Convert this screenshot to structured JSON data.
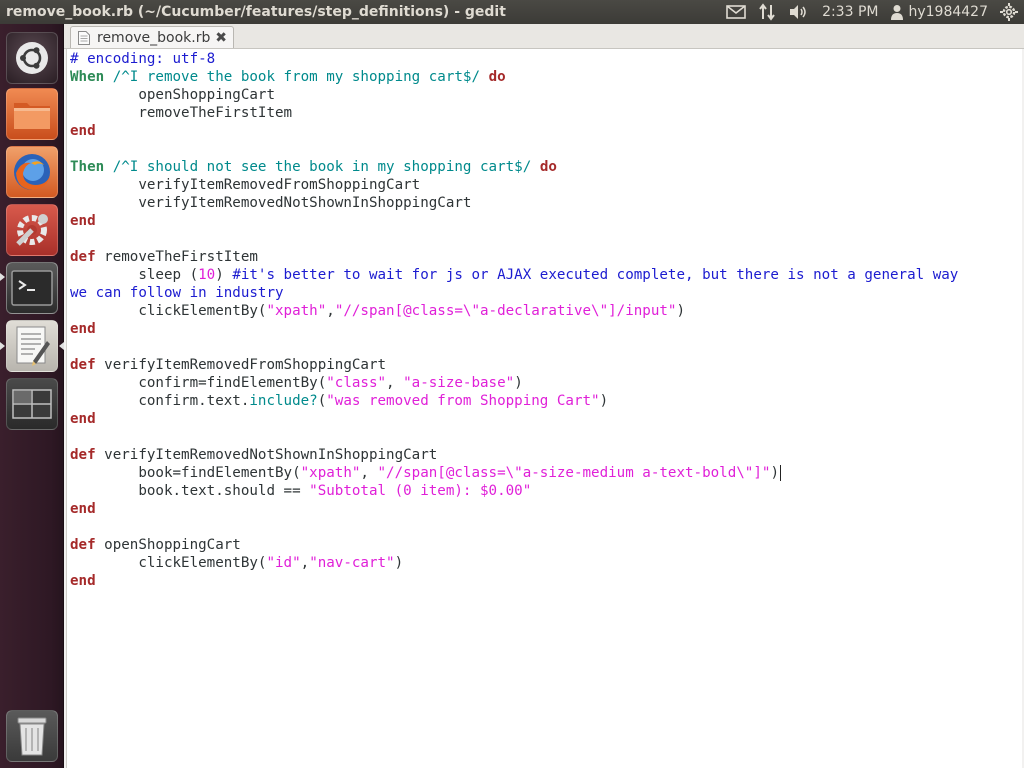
{
  "topbar": {
    "window_title": "remove_book.rb (~/Cucumber/features/step_definitions) - gedit",
    "clock": "2:33 PM",
    "username": "hy1984427",
    "indicator_icons": [
      "mail-icon",
      "network-icon",
      "volume-icon",
      "user-icon",
      "gear-icon"
    ]
  },
  "launcher": {
    "items": [
      "ubuntu-dash-icon",
      "files-icon",
      "firefox-icon",
      "system-settings-icon",
      "terminal-icon",
      "text-editor-icon",
      "workspace-switcher-icon",
      "trash-icon"
    ]
  },
  "editor": {
    "tab_label": "remove_book.rb",
    "tab_icon": "document-icon",
    "close_icon": "close-icon",
    "lines": [
      [
        [
          "comment",
          "# encoding: utf-8"
        ]
      ],
      [
        [
          "step",
          "When"
        ],
        [
          "plain",
          " "
        ],
        [
          "regex",
          "/^I remove the book from my shopping cart$/"
        ],
        [
          "plain",
          " "
        ],
        [
          "keyword",
          "do"
        ]
      ],
      [
        [
          "plain",
          "        openShoppingCart"
        ]
      ],
      [
        [
          "plain",
          "        removeTheFirstItem"
        ]
      ],
      [
        [
          "keyword",
          "end"
        ]
      ],
      [],
      [
        [
          "step",
          "Then"
        ],
        [
          "plain",
          " "
        ],
        [
          "regex",
          "/^I should not see the book in my shopping cart$/"
        ],
        [
          "plain",
          " "
        ],
        [
          "keyword",
          "do"
        ]
      ],
      [
        [
          "plain",
          "        verifyItemRemovedFromShoppingCart"
        ]
      ],
      [
        [
          "plain",
          "        verifyItemRemovedNotShownInShoppingCart"
        ]
      ],
      [
        [
          "keyword",
          "end"
        ]
      ],
      [],
      [
        [
          "keyword",
          "def"
        ],
        [
          "plain",
          " removeTheFirstItem"
        ]
      ],
      [
        [
          "plain",
          "        sleep ("
        ],
        [
          "number",
          "10"
        ],
        [
          "plain",
          ") "
        ],
        [
          "comment",
          "#it's better to wait for js or AJAX executed complete, but there is not a general way"
        ]
      ],
      [
        [
          "comment",
          "we can follow in industry"
        ]
      ],
      [
        [
          "plain",
          "        clickElementBy("
        ],
        [
          "string",
          "\"xpath\""
        ],
        [
          "plain",
          ","
        ],
        [
          "string",
          "\"//span[@class=\\\"a-declarative\\\"]/input\""
        ],
        [
          "plain",
          ")"
        ]
      ],
      [
        [
          "keyword",
          "end"
        ]
      ],
      [],
      [
        [
          "keyword",
          "def"
        ],
        [
          "plain",
          " verifyItemRemovedFromShoppingCart"
        ]
      ],
      [
        [
          "plain",
          "        confirm=findElementBy("
        ],
        [
          "string",
          "\"class\""
        ],
        [
          "plain",
          ", "
        ],
        [
          "string",
          "\"a-size-base\""
        ],
        [
          "plain",
          ")"
        ]
      ],
      [
        [
          "plain",
          "        confirm.text."
        ],
        [
          "method",
          "include?"
        ],
        [
          "plain",
          "("
        ],
        [
          "string",
          "\"was removed from Shopping Cart\""
        ],
        [
          "plain",
          ")"
        ]
      ],
      [
        [
          "keyword",
          "end"
        ]
      ],
      [],
      [
        [
          "keyword",
          "def"
        ],
        [
          "plain",
          " verifyItemRemovedNotShownInShoppingCart"
        ]
      ],
      [
        [
          "plain",
          "        book=findElementBy("
        ],
        [
          "string",
          "\"xpath\""
        ],
        [
          "plain",
          ", "
        ],
        [
          "string",
          "\"//span[@class=\\\"a-size-medium a-text-bold\\\"]\""
        ],
        [
          "plain",
          ")"
        ]
      ],
      [
        [
          "plain",
          "        book.text.should == "
        ],
        [
          "string",
          "\"Subtotal (0 item): $0.00\""
        ]
      ],
      [
        [
          "keyword",
          "end"
        ]
      ],
      [],
      [
        [
          "keyword",
          "def"
        ],
        [
          "plain",
          " openShoppingCart"
        ]
      ],
      [
        [
          "plain",
          "        clickElementBy("
        ],
        [
          "string",
          "\"id\""
        ],
        [
          "plain",
          ","
        ],
        [
          "string",
          "\"nav-cart\""
        ],
        [
          "plain",
          ")"
        ]
      ],
      [
        [
          "keyword",
          "end"
        ]
      ]
    ]
  }
}
